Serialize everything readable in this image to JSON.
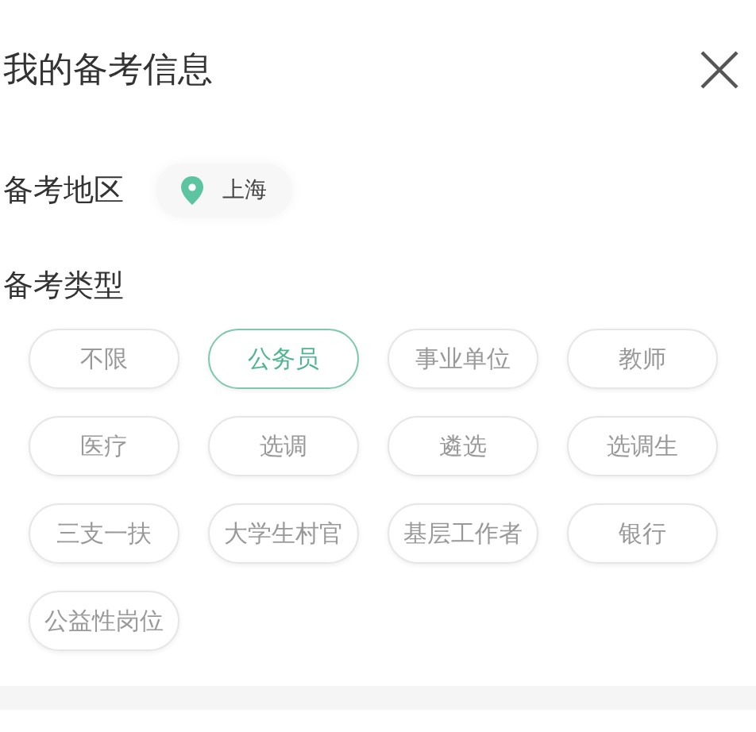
{
  "title": "我的备考信息",
  "region": {
    "label": "备考地区",
    "value": "上海"
  },
  "types": {
    "label": "备考类型",
    "options": [
      {
        "label": "不限",
        "selected": false
      },
      {
        "label": "公务员",
        "selected": true
      },
      {
        "label": "事业单位",
        "selected": false
      },
      {
        "label": "教师",
        "selected": false
      },
      {
        "label": "医疗",
        "selected": false
      },
      {
        "label": "选调",
        "selected": false
      },
      {
        "label": "遴选",
        "selected": false
      },
      {
        "label": "选调生",
        "selected": false
      },
      {
        "label": "三支一扶",
        "selected": false
      },
      {
        "label": "大学生村官",
        "selected": false
      },
      {
        "label": "基层工作者",
        "selected": false
      },
      {
        "label": "银行",
        "selected": false
      },
      {
        "label": "公益性岗位",
        "selected": false
      }
    ]
  }
}
